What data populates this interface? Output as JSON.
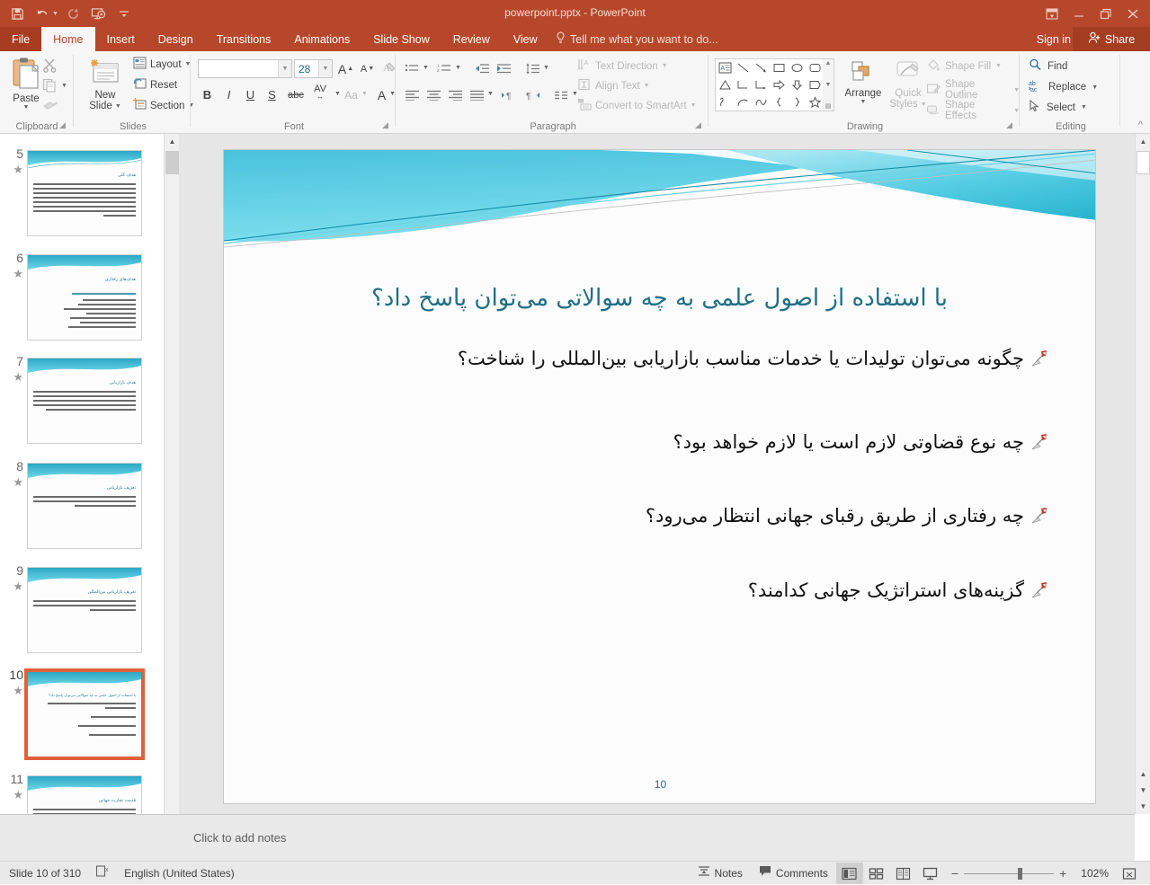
{
  "window": {
    "title": "powerpoint.pptx - PowerPoint",
    "quick_access": [
      "save-icon",
      "undo-icon",
      "redo-icon",
      "start-slideshow-icon",
      "customize-qat-icon"
    ],
    "controls": [
      "ribbon-display-options-icon",
      "minimize-icon",
      "restore-icon",
      "close-icon"
    ],
    "accent_color": "#b7472a"
  },
  "tabs": [
    {
      "label": "File"
    },
    {
      "label": "Home"
    },
    {
      "label": "Insert"
    },
    {
      "label": "Design"
    },
    {
      "label": "Transitions"
    },
    {
      "label": "Animations"
    },
    {
      "label": "Slide Show"
    },
    {
      "label": "Review"
    },
    {
      "label": "View"
    }
  ],
  "active_tab": "Home",
  "tell_me": {
    "label": "Tell me what you want to do...",
    "icon": "lightbulb-icon"
  },
  "sign_in": {
    "label": "Sign in"
  },
  "share": {
    "label": "Share",
    "icon": "share-person-icon"
  },
  "ribbon": {
    "groups": [
      {
        "name": "Clipboard"
      },
      {
        "name": "Slides"
      },
      {
        "name": "Font"
      },
      {
        "name": "Paragraph"
      },
      {
        "name": "Drawing"
      },
      {
        "name": "Editing"
      }
    ],
    "clipboard": {
      "paste_label": "Paste",
      "cut_label": "Cut",
      "copy_label": "Copy",
      "format_painter_label": "Format Painter"
    },
    "slides": {
      "new_slide_label_1": "New",
      "new_slide_label_2": "Slide",
      "layout_label": "Layout",
      "reset_label": "Reset",
      "section_label": "Section"
    },
    "font": {
      "font_name_value": "",
      "font_name_placeholder": "",
      "font_size_value": "28",
      "bold_label": "B",
      "italic_label": "I",
      "underline_label": "U",
      "shadow_label": "S",
      "strikethrough_label": "abc",
      "char_spacing_label": "AV",
      "change_case_label": "Aa",
      "font_color_label": "A",
      "grow_font_label": "A",
      "shrink_font_label": "A"
    },
    "paragraph": {
      "text_direction_label": "Text Direction",
      "align_text_label": "Align Text",
      "convert_smartart_label": "Convert to SmartArt"
    },
    "drawing": {
      "arrange_label": "Arrange",
      "quick_styles_label_1": "Quick",
      "quick_styles_label_2": "Styles",
      "shape_fill_label": "Shape Fill",
      "shape_outline_label": "Shape Outline",
      "shape_effects_label": "Shape Effects"
    },
    "editing": {
      "find_label": "Find",
      "replace_label": "Replace",
      "select_label": "Select"
    }
  },
  "thumbnails": [
    {
      "number": "5",
      "animated": true,
      "title": "هدف کلی",
      "lines": 8,
      "selected": false
    },
    {
      "number": "6",
      "animated": true,
      "title": "هدف‌های رفتاری",
      "lines": 8,
      "selected": false
    },
    {
      "number": "7",
      "animated": true,
      "title": "هدف بازاریابی",
      "lines": 5,
      "selected": false
    },
    {
      "number": "8",
      "animated": true,
      "title": "تعریف بازاریابی",
      "lines": 3,
      "selected": false
    },
    {
      "number": "9",
      "animated": true,
      "title": "تعریف بازاریابی بین‌المللی",
      "lines": 3,
      "selected": false
    },
    {
      "number": "10",
      "animated": true,
      "title": "با استفاده از اصول علمی به چه سوالاتی می‌توان پاسخ داد؟",
      "lines": 5,
      "selected": true
    },
    {
      "number": "11",
      "animated": true,
      "title": "قدمت تجارت جهانی",
      "lines": 6,
      "selected": false
    }
  ],
  "slide": {
    "title": "با استفاده از اصول علمی به چه سوالاتی می‌توان پاسخ داد؟",
    "bullets": [
      {
        "text": "چگونه می‌توان تولیدات یا خدمات مناسب بازاریابی بین‌المللی را شناخت؟",
        "icon": "dart-bullet-icon"
      },
      {
        "text": "چه نوع قضاوتی لازم است یا لازم خواهد بود؟",
        "icon": "dart-bullet-icon"
      },
      {
        "text": "چه رفتاری از طریق رقبای جهانی انتظار می‌رود؟",
        "icon": "dart-bullet-icon"
      },
      {
        "text": "گزینه‌های استراتژیک جهانی کدامند؟",
        "icon": "dart-bullet-icon"
      }
    ],
    "page_number": "10",
    "title_color": "#1f6f87",
    "theme_wave_color": "#45c6dd"
  },
  "notes": {
    "placeholder": "Click to add notes"
  },
  "status_bar": {
    "slide_counter": "Slide 10 of 310",
    "language": "English (United States)",
    "spellcheck_icon": "spellcheck-icon",
    "notes_label": "Notes",
    "comments_label": "Comments",
    "views": [
      "normal-view-icon",
      "slide-sorter-icon",
      "reading-view-icon",
      "slideshow-view-icon"
    ],
    "active_view": "normal-view-icon",
    "zoom_level": "102%",
    "zoom_out_label": "−",
    "zoom_in_label": "+",
    "fit_slide_icon": "fit-to-window-icon"
  }
}
